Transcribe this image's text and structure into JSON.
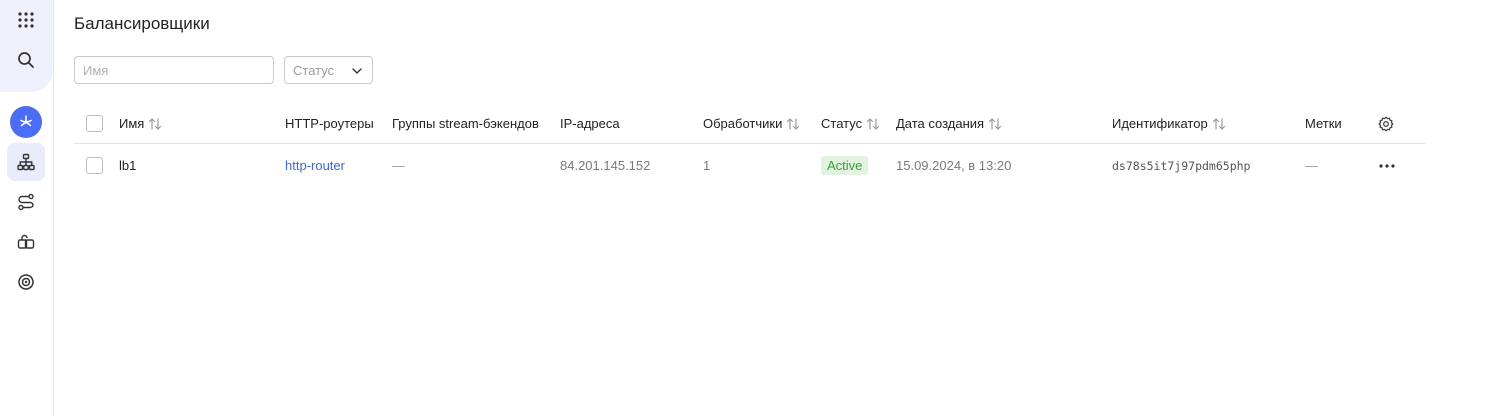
{
  "sidebar": {
    "items": [
      {
        "name": "apps-grid",
        "icon": "grid-icon"
      },
      {
        "name": "search",
        "icon": "search-icon"
      },
      {
        "name": "service",
        "icon": "balancer-service-icon"
      },
      {
        "name": "load-balancers",
        "icon": "hierarchy-icon"
      },
      {
        "name": "routes",
        "icon": "routes-icon"
      },
      {
        "name": "backend-groups",
        "icon": "backend-groups-icon"
      },
      {
        "name": "target-groups",
        "icon": "target-icon"
      }
    ],
    "accent": "#4b6cf5"
  },
  "page": {
    "title": "Балансировщики"
  },
  "filters": {
    "name_placeholder": "Имя",
    "status_label": "Статус"
  },
  "table": {
    "columns": [
      {
        "label": "Имя",
        "sortable": true
      },
      {
        "label": "HTTP-роутеры",
        "sortable": false
      },
      {
        "label": "Группы stream-бэкендов",
        "sortable": false
      },
      {
        "label": "IP-адреса",
        "sortable": false
      },
      {
        "label": "Обработчики",
        "sortable": true
      },
      {
        "label": "Статус",
        "sortable": true
      },
      {
        "label": "Дата создания",
        "sortable": true
      },
      {
        "label": "Идентификатор",
        "sortable": true
      },
      {
        "label": "Метки",
        "sortable": false
      }
    ],
    "rows": [
      {
        "name": "lb1",
        "http_router": "http-router",
        "stream_groups": "—",
        "ip": "84.201.145.152",
        "handlers": "1",
        "status": "Active",
        "created": "15.09.2024, в 13:20",
        "id": "ds78s5it7j97pdm65php",
        "labels": "—"
      }
    ]
  },
  "colors": {
    "link": "#3f66d6",
    "status_active_bg": "#e2f3e1",
    "status_active_text": "#3d9c3a"
  }
}
